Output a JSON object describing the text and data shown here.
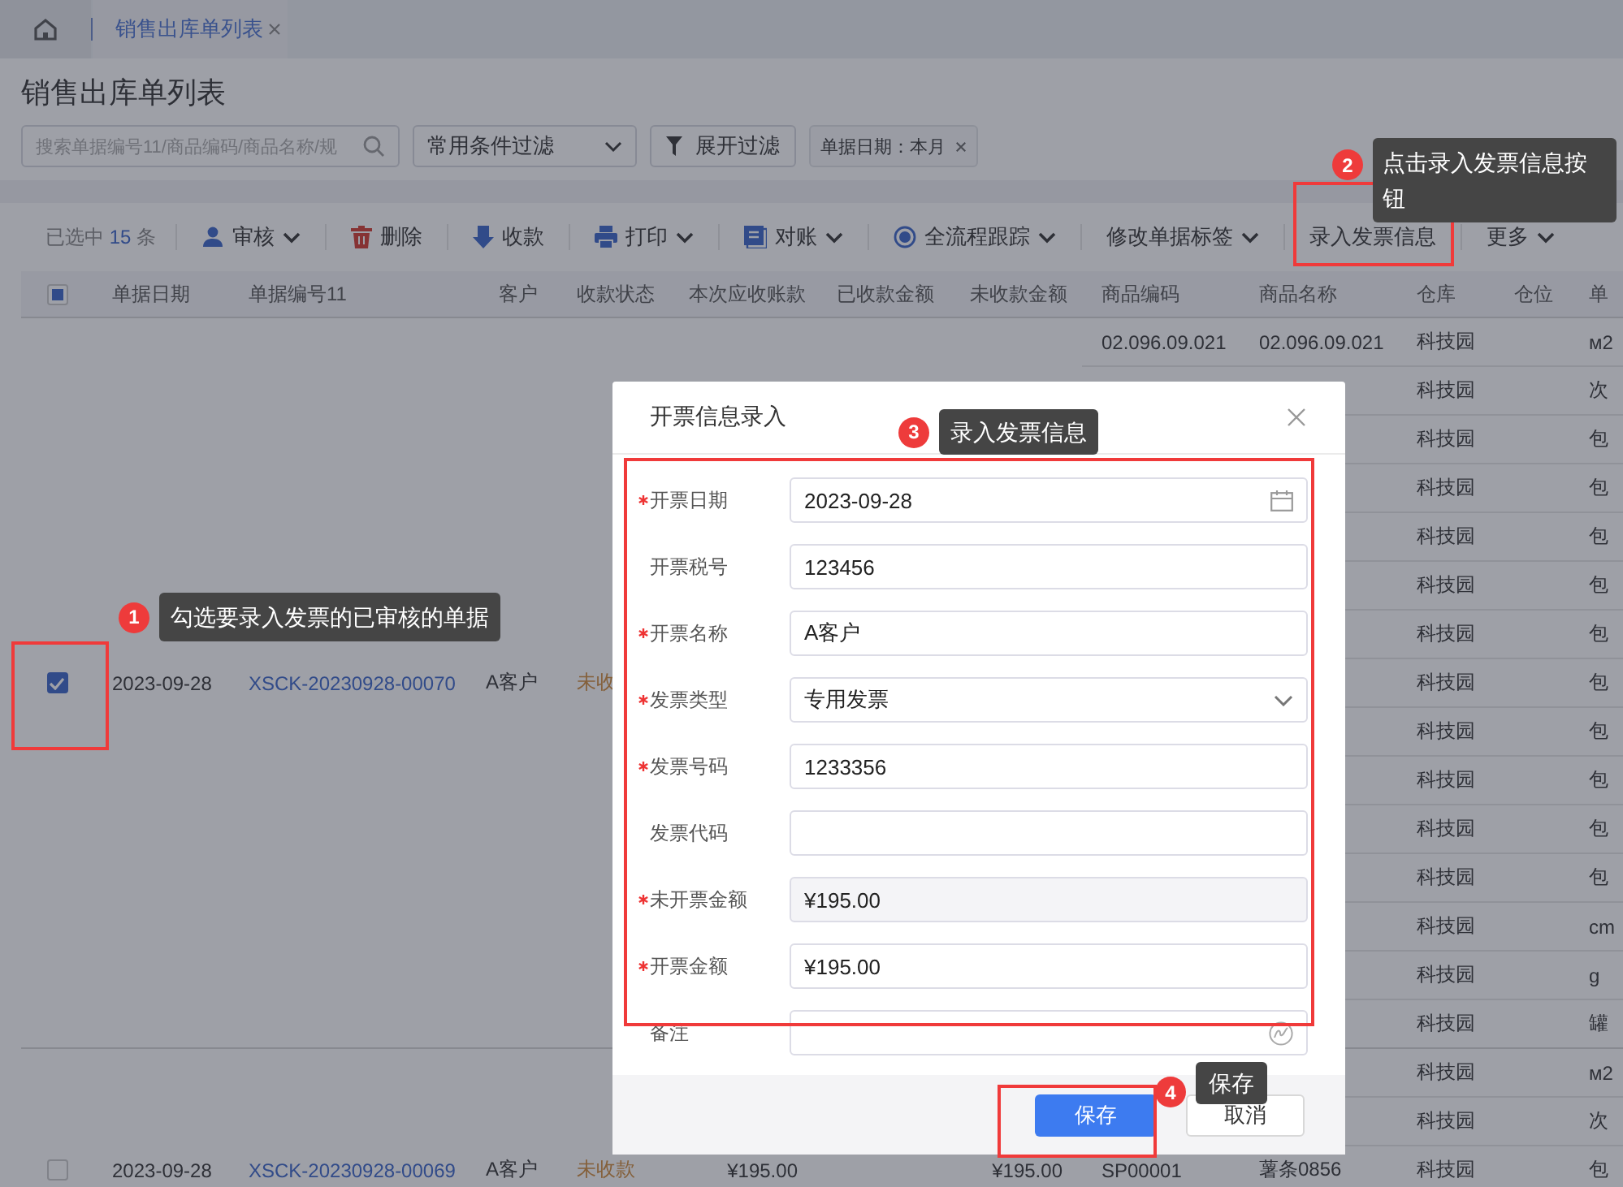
{
  "tabs": [
    {
      "label": "销售出库单列表",
      "selected": true
    }
  ],
  "page_title": "销售出库单列表",
  "filters": {
    "search": {
      "placeholder": "搜索单据编号11/商品编码/商品名称/规"
    },
    "condition_select": "常用条件过滤",
    "expand_button": "展开过滤",
    "tags": [
      "单据日期：本月"
    ]
  },
  "toolbar": {
    "selection": {
      "prefix": "已选中",
      "count": "15",
      "suffix": "条"
    },
    "actions": [
      {
        "label": "审核",
        "kind": "person",
        "dropdown": true
      },
      {
        "label": "删除",
        "kind": "trash",
        "dropdown": false
      },
      {
        "label": "收款",
        "kind": "receive",
        "dropdown": false
      },
      {
        "label": "打印",
        "kind": "printer",
        "dropdown": true
      },
      {
        "label": "对账",
        "kind": "ledger",
        "dropdown": true
      },
      {
        "label": "全流程跟踪",
        "kind": "target",
        "dropdown": true
      },
      {
        "label": "修改单据标签",
        "kind": "plain",
        "dropdown": true
      },
      {
        "label": "录入发票信息",
        "kind": "plain",
        "dropdown": false
      },
      {
        "label": "更多",
        "kind": "plain",
        "dropdown": true
      }
    ]
  },
  "table": {
    "header_checkbox": {
      "indeterminate": true
    },
    "columns": [
      "单据日期",
      "单据编号11",
      "客户",
      "收款状态",
      "本次应收账款",
      "已收款金额",
      "未收款金额",
      "商品编码",
      "商品名称",
      "仓库",
      "仓位",
      "单"
    ],
    "lines": [
      {
        "group_start": true,
        "code": "02.096.09.021",
        "name": "02.096.09.021",
        "warehouse": "科技园",
        "unit": "м2"
      },
      {
        "group_start": false,
        "warehouse": "科技园",
        "unit": "次"
      },
      {
        "group_start": false,
        "warehouse": "科技园",
        "unit": "包"
      },
      {
        "group_start": false,
        "warehouse": "科技园",
        "unit": "包"
      },
      {
        "group_start": false,
        "warehouse": "科技园",
        "unit": "包"
      },
      {
        "group_start": false,
        "warehouse": "科技园",
        "unit": "包"
      },
      {
        "group_start": false,
        "warehouse": "科技园",
        "unit": "包"
      },
      {
        "group_start": false,
        "order": {
          "checked": true,
          "date": "2023-09-28",
          "number": "XSCK-20230928-00070",
          "customer": "A客户",
          "status": "未收"
        },
        "warehouse": "科技园",
        "unit": "包"
      },
      {
        "group_start": false,
        "warehouse": "科技园",
        "unit": "包"
      },
      {
        "group_start": false,
        "warehouse": "科技园",
        "unit": "包"
      },
      {
        "group_start": false,
        "warehouse": "科技园",
        "unit": "包"
      },
      {
        "group_start": false,
        "warehouse": "科技园",
        "unit": "包"
      },
      {
        "group_start": false,
        "warehouse": "科技园",
        "unit": "cm"
      },
      {
        "group_start": false,
        "warehouse": "科技园",
        "unit": "g"
      },
      {
        "group_start": false,
        "warehouse": "科技园",
        "unit": "罐"
      },
      {
        "group_start": true,
        "warehouse": "科技园",
        "unit": "м2"
      },
      {
        "group_start": false,
        "warehouse": "科技园",
        "unit": "次"
      },
      {
        "group_start": false,
        "order": {
          "checked": false,
          "date": "2023-09-28",
          "number": "XSCK-20230928-00069",
          "customer": "A客户",
          "status": "未收款",
          "receivable": "¥195.00",
          "unpaid": "¥195.00"
        },
        "code": "SP00001",
        "name": "薯条0856",
        "warehouse": "科技园",
        "unit": "包"
      }
    ]
  },
  "dialog": {
    "title": "开票信息录入",
    "fields": [
      {
        "label": "开票日期",
        "required": true,
        "kind": "date",
        "value": "2023-09-28"
      },
      {
        "label": "开票税号",
        "required": false,
        "kind": "text",
        "value": "123456"
      },
      {
        "label": "开票名称",
        "required": true,
        "kind": "text",
        "value": "A客户"
      },
      {
        "label": "发票类型",
        "required": true,
        "kind": "select",
        "value": "专用发票"
      },
      {
        "label": "发票号码",
        "required": true,
        "kind": "text",
        "value": "1233356"
      },
      {
        "label": "发票代码",
        "required": false,
        "kind": "text"
      },
      {
        "label": "未开票金额",
        "required": true,
        "kind": "readonly",
        "value": "¥195.00"
      },
      {
        "label": "开票金额",
        "required": true,
        "kind": "text",
        "value": "¥195.00"
      },
      {
        "label": "备注",
        "required": false,
        "kind": "note"
      }
    ],
    "buttons": [
      {
        "label": "保存",
        "kind": "primary"
      },
      {
        "label": "取消",
        "kind": "default"
      }
    ]
  },
  "annotations": [
    {
      "number": "1",
      "text": "勾选要录入发票的已审核的单据"
    },
    {
      "number": "2",
      "text": "点击录入发票信息按钮"
    },
    {
      "number": "3",
      "text": "录入发票信息"
    },
    {
      "number": "4",
      "text": "保存"
    }
  ]
}
